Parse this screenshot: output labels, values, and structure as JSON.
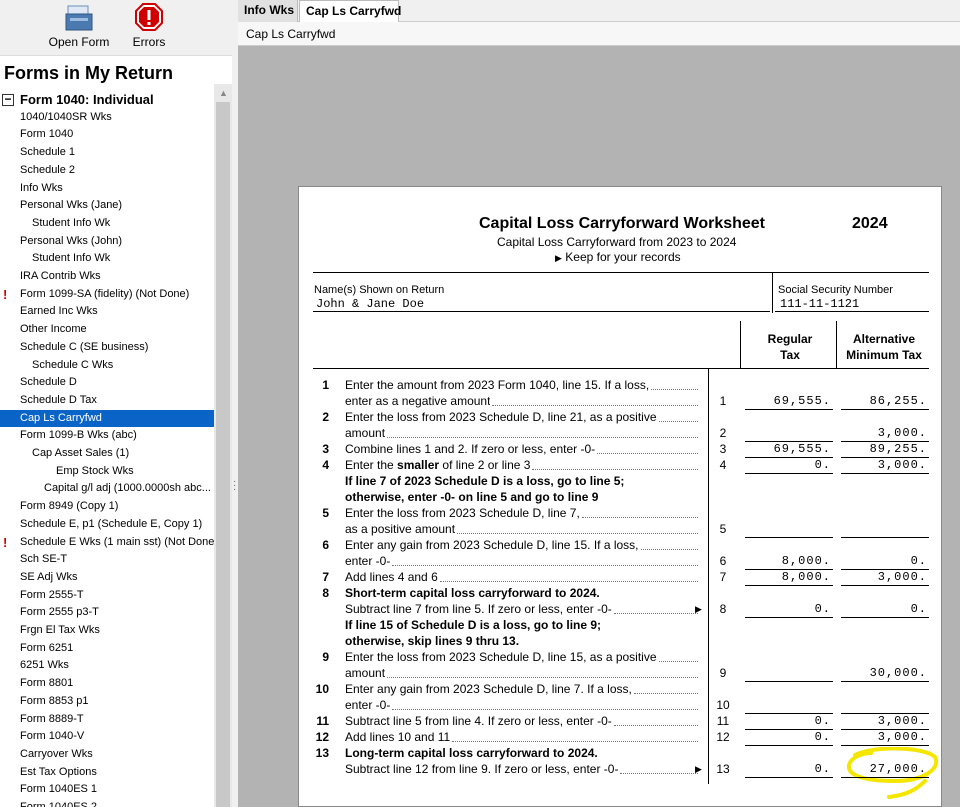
{
  "toolbar": {
    "open_form": "Open Form",
    "errors": "Errors"
  },
  "left_panel": {
    "title": "Forms in My Return",
    "root": "Form 1040:  Individual",
    "items": [
      {
        "label": "1040/1040SR Wks",
        "indent": 0,
        "warn": false
      },
      {
        "label": "Form 1040",
        "indent": 0,
        "warn": false
      },
      {
        "label": "Schedule 1",
        "indent": 0,
        "warn": false
      },
      {
        "label": "Schedule 2",
        "indent": 0,
        "warn": false
      },
      {
        "label": "Info Wks",
        "indent": 0,
        "warn": false
      },
      {
        "label": "Personal Wks (Jane)",
        "indent": 0,
        "warn": false
      },
      {
        "label": "Student Info Wk",
        "indent": 1,
        "warn": false
      },
      {
        "label": "Personal Wks (John)",
        "indent": 0,
        "warn": false
      },
      {
        "label": "Student Info Wk",
        "indent": 1,
        "warn": false
      },
      {
        "label": "IRA Contrib Wks",
        "indent": 0,
        "warn": false
      },
      {
        "label": "Form 1099-SA (fidelity) (Not Done)",
        "indent": 0,
        "warn": true
      },
      {
        "label": "Earned Inc Wks",
        "indent": 0,
        "warn": false
      },
      {
        "label": "Other Income",
        "indent": 0,
        "warn": false
      },
      {
        "label": "Schedule C (SE business)",
        "indent": 0,
        "warn": false
      },
      {
        "label": "Schedule C Wks",
        "indent": 1,
        "warn": false
      },
      {
        "label": "Schedule D",
        "indent": 0,
        "warn": false
      },
      {
        "label": "Schedule D Tax",
        "indent": 0,
        "warn": false
      },
      {
        "label": "Cap Ls Carryfwd",
        "indent": 0,
        "warn": false,
        "selected": true
      },
      {
        "label": "Form 1099-B Wks (abc)",
        "indent": 0,
        "warn": false
      },
      {
        "label": "Cap Asset Sales (1)",
        "indent": 1,
        "warn": false
      },
      {
        "label": "Emp Stock Wks",
        "indent": 3,
        "warn": false
      },
      {
        "label": "Capital g/l adj (1000.0000sh abc...",
        "indent": 2,
        "warn": false
      },
      {
        "label": "Form 8949 (Copy 1)",
        "indent": 0,
        "warn": false
      },
      {
        "label": "Schedule E, p1 (Schedule E, Copy 1)",
        "indent": 0,
        "warn": false
      },
      {
        "label": "Schedule E Wks (1 main sst) (Not Done)",
        "indent": 0,
        "warn": true
      },
      {
        "label": "Sch SE-T",
        "indent": 0,
        "warn": false
      },
      {
        "label": "SE Adj Wks",
        "indent": 0,
        "warn": false
      },
      {
        "label": "Form 2555-T",
        "indent": 0,
        "warn": false
      },
      {
        "label": "Form 2555 p3-T",
        "indent": 0,
        "warn": false
      },
      {
        "label": "Frgn El Tax Wks",
        "indent": 0,
        "warn": false
      },
      {
        "label": "Form 6251",
        "indent": 0,
        "warn": false
      },
      {
        "label": "6251 Wks",
        "indent": 0,
        "warn": false
      },
      {
        "label": "Form 8801",
        "indent": 0,
        "warn": false
      },
      {
        "label": "Form 8853 p1",
        "indent": 0,
        "warn": false
      },
      {
        "label": "Form 8889-T",
        "indent": 0,
        "warn": false
      },
      {
        "label": "Form 1040-V",
        "indent": 0,
        "warn": false
      },
      {
        "label": "Carryover Wks",
        "indent": 0,
        "warn": false
      },
      {
        "label": "Est Tax Options",
        "indent": 0,
        "warn": false
      },
      {
        "label": "Form 1040ES 1",
        "indent": 0,
        "warn": false
      },
      {
        "label": "Form 1040ES 2",
        "indent": 0,
        "warn": false
      }
    ]
  },
  "tabs": [
    {
      "label": "Info Wks"
    },
    {
      "label": "Cap Ls Carryfwd"
    }
  ],
  "breadcrumb": "Cap Ls Carryfwd",
  "worksheet": {
    "title": "Capital Loss Carryforward Worksheet",
    "year": "2024",
    "subtitle": "Capital Loss Carryforward from 2023 to 2024",
    "keep": "Keep for your records",
    "names_label": "Name(s) Shown on Return",
    "names_value": "John & Jane Doe",
    "ssn_label": "Social Security Number",
    "ssn_value": "111-11-1121",
    "col_regular": "Regular\nTax",
    "col_regular_1": "Regular",
    "col_regular_2": "Tax",
    "col_amt_1": "Alternative",
    "col_amt_2": "Minimum Tax",
    "lines": [
      {
        "num": "1",
        "text1": "Enter the amount from 2023 Form 1040, line 15. If a loss,",
        "text2": "enter as a negative amount",
        "box": "1",
        "regular": "69,555.",
        "amt": "86,255."
      },
      {
        "num": "2",
        "text1": "Enter the loss from 2023 Schedule D, line 21, as a positive",
        "text2": "amount",
        "box": "2",
        "regular": "",
        "amt": "3,000."
      },
      {
        "num": "3",
        "text1": "Combine lines 1 and 2. If zero or less, enter -0-",
        "box": "3",
        "regular": "69,555.",
        "amt": "89,255."
      },
      {
        "num": "4",
        "text1a": "Enter the ",
        "text1b": "smaller",
        "text1c": " of line 2 or line 3",
        "box": "4",
        "regular": "0.",
        "amt": "3,000."
      },
      {
        "num": "",
        "bold1": "If line 7 of 2023 Schedule D is a loss, go to line 5;",
        "bold2": "otherwise, enter -0- on line 5 and go to line 9"
      },
      {
        "num": "5",
        "text1": "Enter the loss from 2023 Schedule D, line 7,",
        "text2": "as a positive amount",
        "box": "5",
        "regular": "",
        "amt": ""
      },
      {
        "num": "6",
        "text1": "Enter any gain from 2023 Schedule D, line 15. If a loss,",
        "text2": "enter -0-",
        "box": "6",
        "regular": "8,000.",
        "amt": "0."
      },
      {
        "num": "7",
        "text1": "Add lines 4 and 6",
        "box": "7",
        "regular": "8,000.",
        "amt": "3,000."
      },
      {
        "num": "8",
        "bold1": "Short-term capital loss carryforward to 2024.",
        "text2": "Subtract line 7 from line 5. If zero or less, enter -0-",
        "box": "8",
        "regular": "0.",
        "amt": "0."
      },
      {
        "num": "",
        "bold1": "If line 15 of Schedule D is a loss, go to line 9;",
        "bold2": "otherwise, skip lines 9 thru 13."
      },
      {
        "num": "9",
        "text1": "Enter the loss from 2023 Schedule D, line 15, as a positive",
        "text2": "amount",
        "box": "9",
        "regular": "",
        "amt": "30,000."
      },
      {
        "num": "10",
        "text1": "Enter any gain from 2023 Schedule D, line 7. If a loss,",
        "text2": "enter -0-",
        "box": "10",
        "regular": "",
        "amt": ""
      },
      {
        "num": "11",
        "text1": "Subtract line 5 from line 4. If zero or less, enter -0-",
        "box": "11",
        "regular": "0.",
        "amt": "3,000."
      },
      {
        "num": "12",
        "text1": "Add lines 10 and 11",
        "box": "12",
        "regular": "0.",
        "amt": "3,000."
      },
      {
        "num": "13",
        "bold1": "Long-term capital loss carryforward to 2024.",
        "text2": "Subtract line 12 from line 9. If zero or less, enter -0-",
        "box": "13",
        "regular": "0.",
        "amt": "27,000."
      }
    ]
  },
  "colors": {
    "selection": "#0a64c8",
    "highlight": "#f5e600",
    "warning": "#d00000"
  }
}
